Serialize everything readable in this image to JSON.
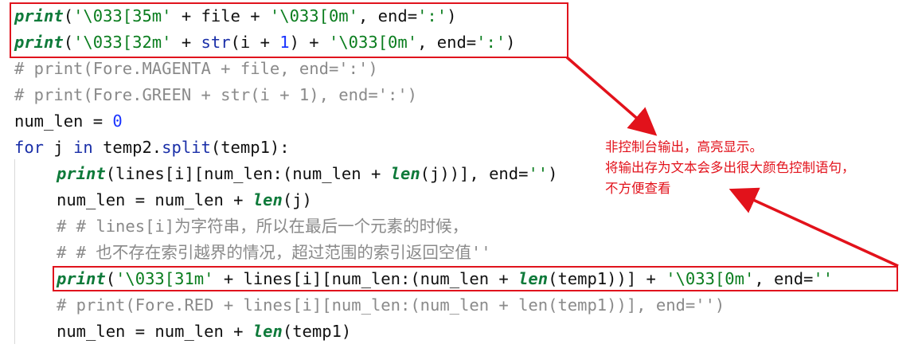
{
  "code_lines": [
    {
      "parts": [
        {
          "t": "print",
          "c": "fn-it"
        },
        {
          "t": "(",
          "c": ""
        },
        {
          "t": "'\\033[35m'",
          "c": "str"
        },
        {
          "t": " + file + ",
          "c": ""
        },
        {
          "t": "'\\033[0m'",
          "c": "str"
        },
        {
          "t": ", end=",
          "c": ""
        },
        {
          "t": "':'",
          "c": "str"
        },
        {
          "t": ")",
          "c": ""
        }
      ],
      "indent": false
    },
    {
      "parts": [
        {
          "t": "print",
          "c": "fn-it"
        },
        {
          "t": "(",
          "c": ""
        },
        {
          "t": "'\\033[32m'",
          "c": "str"
        },
        {
          "t": " + ",
          "c": ""
        },
        {
          "t": "str",
          "c": "bi"
        },
        {
          "t": "(i + ",
          "c": ""
        },
        {
          "t": "1",
          "c": "num"
        },
        {
          "t": ") + ",
          "c": ""
        },
        {
          "t": "'\\033[0m'",
          "c": "str"
        },
        {
          "t": ", end=",
          "c": ""
        },
        {
          "t": "':'",
          "c": "str"
        },
        {
          "t": ")",
          "c": ""
        }
      ],
      "indent": false
    },
    {
      "parts": [
        {
          "t": "# print(Fore.MAGENTA + file, end=':')",
          "c": "cmt"
        }
      ],
      "indent": false
    },
    {
      "parts": [
        {
          "t": "# print(Fore.GREEN + str(i + 1), end=':')",
          "c": "cmt"
        }
      ],
      "indent": false
    },
    {
      "parts": [
        {
          "t": "num_len = ",
          "c": ""
        },
        {
          "t": "0",
          "c": "num"
        }
      ],
      "indent": false
    },
    {
      "parts": [
        {
          "t": "for",
          "c": "kw"
        },
        {
          "t": " j ",
          "c": ""
        },
        {
          "t": "in",
          "c": "kw"
        },
        {
          "t": " temp2.",
          "c": ""
        },
        {
          "t": "split",
          "c": "bi"
        },
        {
          "t": "(temp1):",
          "c": ""
        }
      ],
      "indent": false
    },
    {
      "parts": [
        {
          "t": "print",
          "c": "fn-it"
        },
        {
          "t": "(lines[i][num_len:(num_len + ",
          "c": ""
        },
        {
          "t": "len",
          "c": "fn-it"
        },
        {
          "t": "(j))], end=",
          "c": ""
        },
        {
          "t": "''",
          "c": "str"
        },
        {
          "t": ")",
          "c": ""
        }
      ],
      "indent": true
    },
    {
      "parts": [
        {
          "t": "num_len = num_len + ",
          "c": ""
        },
        {
          "t": "len",
          "c": "fn-it"
        },
        {
          "t": "(j)",
          "c": ""
        }
      ],
      "indent": true
    },
    {
      "parts": [
        {
          "t": "# # lines[i]",
          "c": "cmt"
        },
        {
          "t": "为字符串，所以在最后一个元素的时候，",
          "c": "cmt cn"
        }
      ],
      "indent": true
    },
    {
      "parts": [
        {
          "t": "# # ",
          "c": "cmt"
        },
        {
          "t": "也不存在索引越界的情况，超过范围的索引返回空值",
          "c": "cmt cn"
        },
        {
          "t": "''",
          "c": "cmt"
        }
      ],
      "indent": true
    },
    {
      "parts": [
        {
          "t": "print",
          "c": "fn-it"
        },
        {
          "t": "(",
          "c": ""
        },
        {
          "t": "'\\033[31m'",
          "c": "str"
        },
        {
          "t": " + lines[i][num_len:(num_len + ",
          "c": ""
        },
        {
          "t": "len",
          "c": "fn-it"
        },
        {
          "t": "(temp1))] + ",
          "c": ""
        },
        {
          "t": "'\\033[0m'",
          "c": "str"
        },
        {
          "t": ", end=",
          "c": ""
        },
        {
          "t": "''",
          "c": "str"
        }
      ],
      "indent": true
    },
    {
      "parts": [
        {
          "t": "# print(Fore.RED + lines[i][num_len:(num_len + len(temp1))], end='')",
          "c": "cmt"
        }
      ],
      "indent": true
    },
    {
      "parts": [
        {
          "t": "num_len = num_len + ",
          "c": ""
        },
        {
          "t": "len",
          "c": "fn-it"
        },
        {
          "t": "(temp1)",
          "c": ""
        }
      ],
      "indent": true
    }
  ],
  "annotation": {
    "line1": "非控制台输出，高亮显示。",
    "line2": "将输出存为文本会多出很大颜色控制语句，",
    "line3": "不方便查看"
  },
  "colors": {
    "highlight_box": "#e0131d",
    "annotation_text": "#e2121b"
  }
}
